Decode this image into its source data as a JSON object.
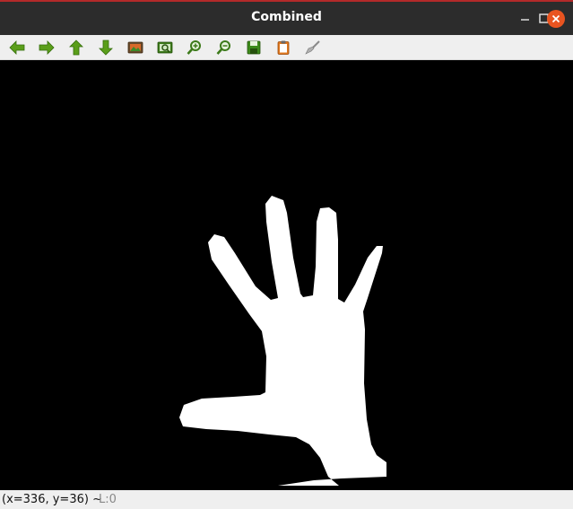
{
  "window": {
    "title": "Combined"
  },
  "toolbar": {
    "buttons": [
      {
        "name": "pan-left",
        "icon": "arrow-left-icon"
      },
      {
        "name": "pan-right",
        "icon": "arrow-right-icon"
      },
      {
        "name": "pan-up",
        "icon": "arrow-up-icon"
      },
      {
        "name": "pan-down",
        "icon": "arrow-down-icon"
      },
      {
        "name": "zoom-fit",
        "icon": "image-icon"
      },
      {
        "name": "zoom-region",
        "icon": "zoom-window-icon"
      },
      {
        "name": "zoom-in",
        "icon": "zoom-in-icon"
      },
      {
        "name": "zoom-out",
        "icon": "zoom-out-icon"
      },
      {
        "name": "save-image",
        "icon": "save-icon"
      },
      {
        "name": "copy-clipboard",
        "icon": "clipboard-icon"
      },
      {
        "name": "properties",
        "icon": "brush-icon"
      }
    ],
    "accent_green": "#4e9a06"
  },
  "status": {
    "coords": "(x=336, y=36) ~",
    "level": "L:0"
  },
  "colors": {
    "close_button": "#e95420",
    "titlebar": "#2c2c2c",
    "mask_fg": "#ffffff",
    "mask_bg": "#000000"
  }
}
